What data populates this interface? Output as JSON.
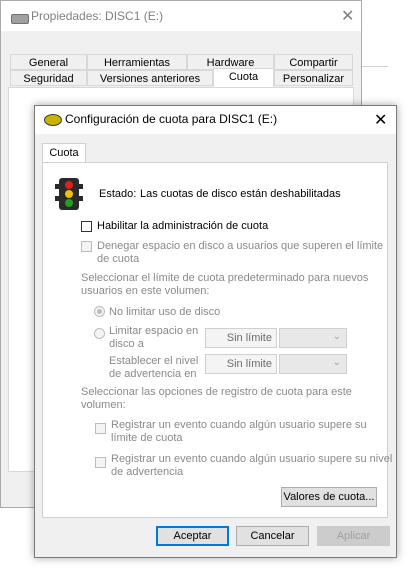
{
  "background_window": {
    "title": "Propiedades: DISC1 (E:)",
    "tabs_row1": [
      "General",
      "Herramientas",
      "Hardware",
      "Compartir"
    ],
    "tabs_row2": [
      "Seguridad",
      "Versiones anteriores",
      "Cuota",
      "Personalizar"
    ],
    "selected_tab": "Cuota"
  },
  "dialog": {
    "title": "Configuración de cuota para DISC1 (E:)",
    "tab": "Cuota",
    "status_label": "Estado:",
    "status_text": "Las cuotas de disco están deshabilitadas",
    "enable_quota": "Habilitar la administración de cuota",
    "deny_space_line1": "Denegar espacio en disco a usuarios que superen el límite",
    "deny_space_line2": "de cuota",
    "default_limit_line1": "Seleccionar el límite de cuota predeterminado para nuevos",
    "default_limit_line2": "usuarios en este volumen:",
    "no_limit": "No limitar uso de disco",
    "limit_space_line1": "Limitar espacio en",
    "limit_space_line2": "disco a",
    "limit_value": "Sin límite",
    "warning_line1": "Establecer el nivel",
    "warning_line2": "de advertencia en",
    "warning_value": "Sin límite",
    "logging_line1": "Seleccionar las opciones de registro de cuota para este",
    "logging_line2": "volumen:",
    "log_exceed_line1": "Registrar un evento cuando algún usuario supere su",
    "log_exceed_line2": "límite de cuota",
    "log_warning_line1": "Registrar un evento cuando algún usuario supere su nivel",
    "log_warning_line2": "de advertencia",
    "quota_values_button": "Valores de cuota...",
    "accept": "Aceptar",
    "cancel": "Cancelar",
    "apply": "Aplicar",
    "close_glyph": "✕"
  },
  "colors": {
    "accent_focus": "#0078d7",
    "disabled_text": "#8a8a8a",
    "traffic_red": "#e02020",
    "traffic_yellow": "#f0c000",
    "traffic_green": "#20a020"
  }
}
